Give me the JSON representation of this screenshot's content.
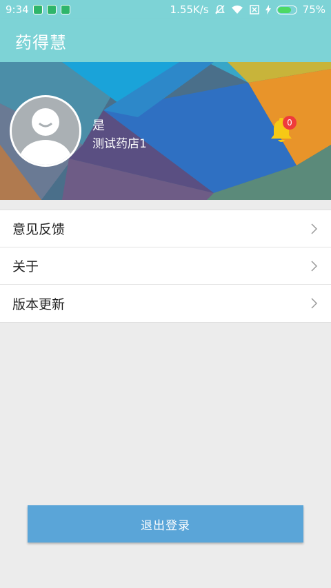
{
  "status_bar": {
    "time": "9:34",
    "network_speed": "1.55K/s",
    "battery_percent": "75%",
    "battery_level": 0.75,
    "icons": [
      "shield-icon",
      "battery-saver-icon",
      "android-icon",
      "mute-icon",
      "wifi-icon",
      "sim-off-icon",
      "charging-icon"
    ]
  },
  "app_bar": {
    "title": "药得慧"
  },
  "profile": {
    "user_name": "是",
    "store_name": "测试药店1",
    "notification_count": "0",
    "colors": {
      "bell": "#f6c915",
      "badge": "#ef3b3b"
    }
  },
  "menu": {
    "items": [
      {
        "label": "意见反馈"
      },
      {
        "label": "关于"
      },
      {
        "label": "版本更新"
      }
    ]
  },
  "logout_label": "退出登录",
  "colors": {
    "primary": "#7dd3d6",
    "logout": "#5aa5d8",
    "background": "#ececec"
  }
}
